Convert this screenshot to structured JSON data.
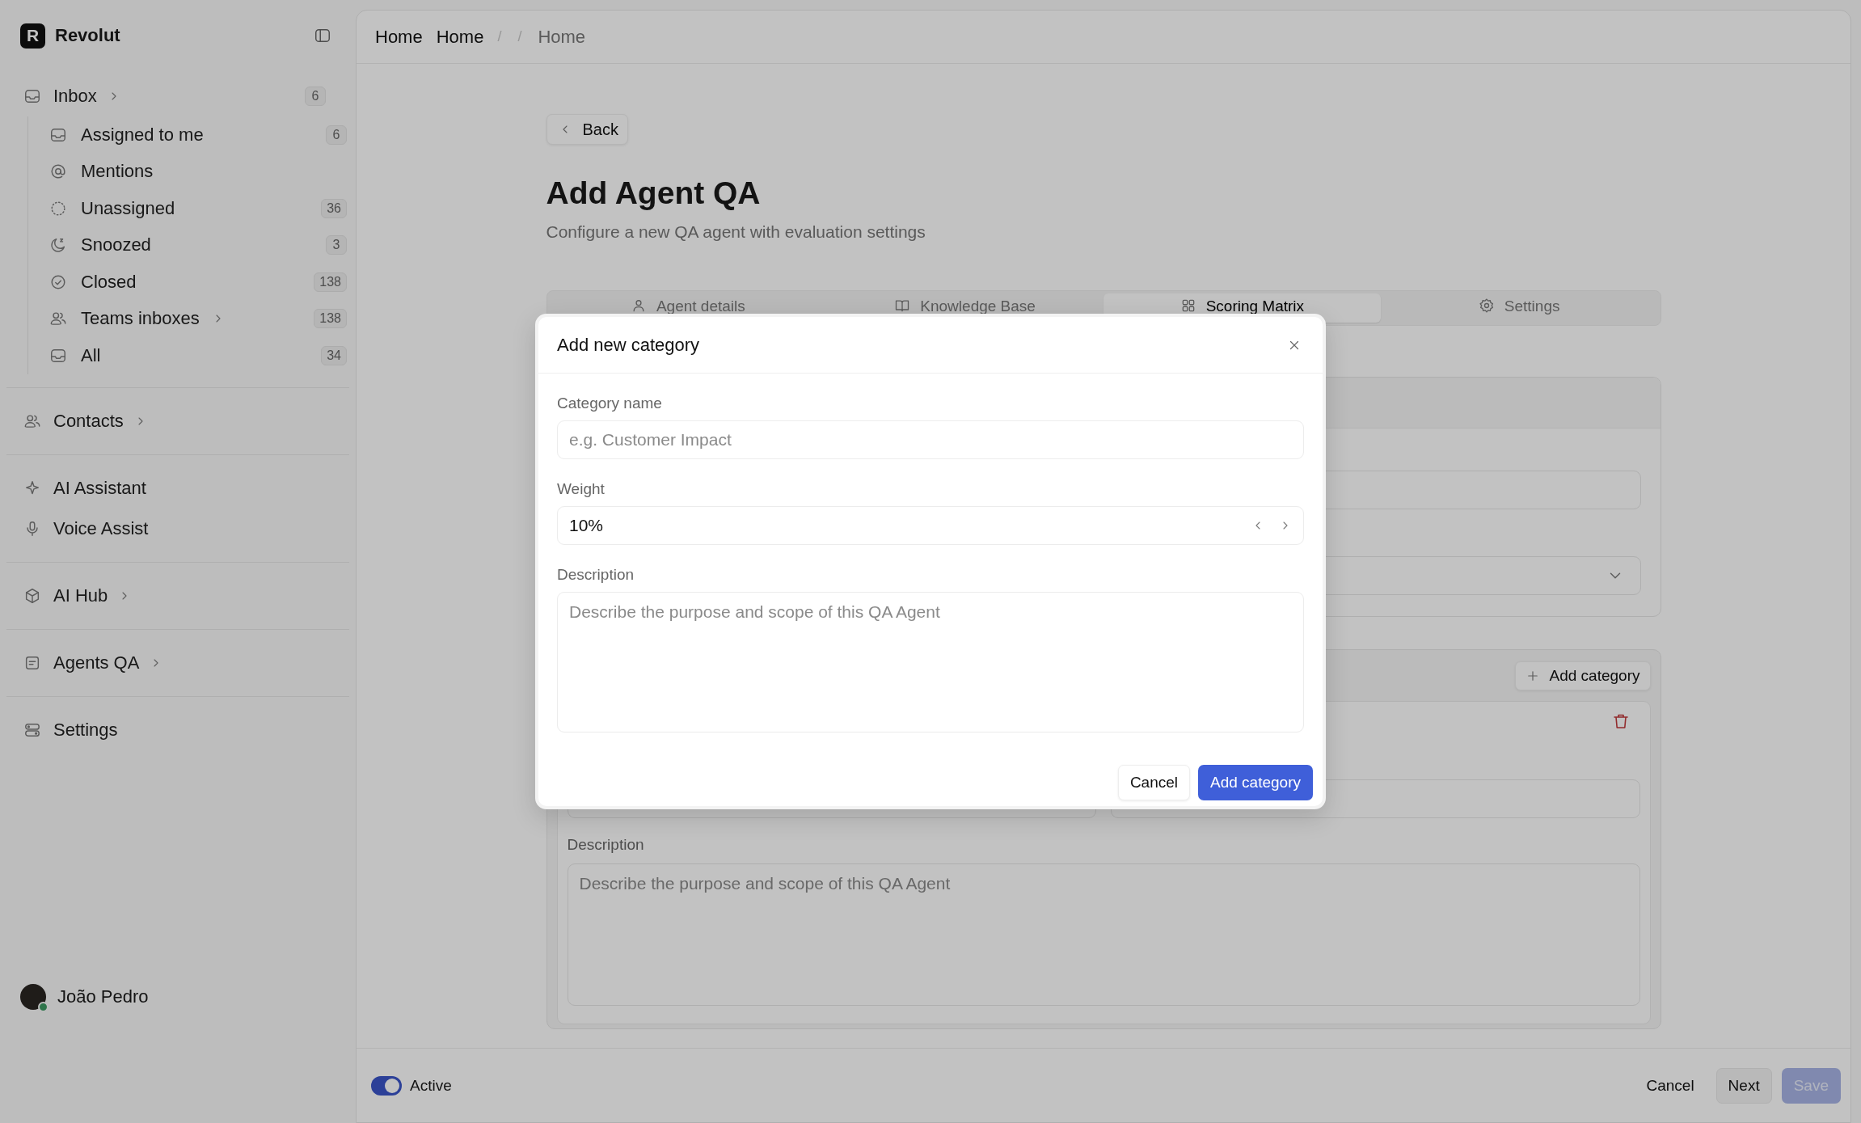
{
  "brand": {
    "logo_letter": "R",
    "name": "Revolut"
  },
  "sidebar": {
    "sections": [
      {
        "items": [
          {
            "label": "Inbox",
            "count": "6",
            "chevron": true,
            "children": [
              {
                "label": "Assigned to me",
                "count": "6",
                "chevron": false
              },
              {
                "label": "Mentions",
                "chevron": false
              },
              {
                "label": "Unassigned",
                "count": "36",
                "chevron": false
              },
              {
                "label": "Snoozed",
                "count": "3",
                "chevron": false
              },
              {
                "label": "Closed",
                "count": "138",
                "chevron": false
              },
              {
                "label": "Teams inboxes",
                "count": "138",
                "chevron": true
              },
              {
                "label": "All",
                "count": "34",
                "chevron": false
              }
            ]
          }
        ]
      },
      {
        "items": [
          {
            "label": "Contacts",
            "chevron": true
          }
        ]
      },
      {
        "items": [
          {
            "label": "AI Assistant",
            "chevron": false
          },
          {
            "label": "Voice Assist",
            "chevron": false
          }
        ]
      },
      {
        "items": [
          {
            "label": "AI Hub",
            "chevron": true
          }
        ]
      },
      {
        "items": [
          {
            "label": "Agents QA",
            "chevron": true
          }
        ]
      },
      {
        "items": [
          {
            "label": "Settings",
            "chevron": false
          }
        ]
      }
    ]
  },
  "user": {
    "name": "João Pedro",
    "online": true
  },
  "breadcrumb": [
    {
      "kind": "link",
      "text": "Home"
    },
    {
      "kind": "link",
      "text": "Home"
    },
    {
      "kind": "separator",
      "text": "/"
    },
    {
      "kind": "separator",
      "text": "/"
    },
    {
      "kind": "current",
      "text": "Home"
    }
  ],
  "page": {
    "back": "Back",
    "title": "Add Agent QA",
    "subtitle": "Configure a new QA agent with evaluation settings"
  },
  "tabs": [
    {
      "label": "Agent details",
      "selected": false
    },
    {
      "label": "Knowledge Base",
      "selected": false
    },
    {
      "label": "Scoring Matrix",
      "selected": true
    },
    {
      "label": "Settings",
      "selected": false
    }
  ],
  "categories": {
    "add_button": "Add category",
    "description": {
      "label": "Description",
      "placeholder": "Describe the purpose and scope of this QA Agent"
    }
  },
  "footer": {
    "toggle": {
      "label": "Active",
      "on": true
    },
    "buttons": [
      {
        "label": "Cancel",
        "kind": "ghost",
        "disabled": false
      },
      {
        "label": "Next",
        "kind": "secondary",
        "disabled": false
      },
      {
        "label": "Save",
        "kind": "primary",
        "disabled": true
      }
    ]
  },
  "dialog": {
    "title": "Add new category",
    "fields": [
      {
        "kind": "text",
        "label": "Category name",
        "placeholder": "e.g. Customer Impact"
      },
      {
        "kind": "stepper",
        "label": "Weight",
        "value": "10%"
      },
      {
        "kind": "textarea",
        "label": "Description",
        "placeholder": "Describe the purpose and scope of this QA Agent"
      }
    ],
    "buttons": [
      {
        "label": "Cancel",
        "kind": "secondary"
      },
      {
        "label": "Add category",
        "kind": "primary"
      }
    ]
  }
}
